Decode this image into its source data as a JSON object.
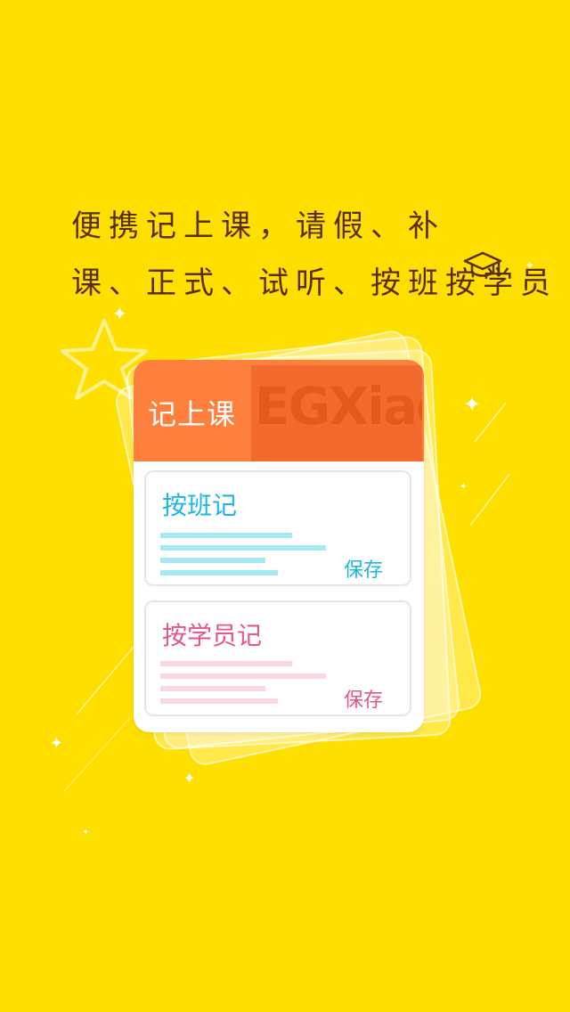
{
  "headline": {
    "line1": "便携记上课，请假、补",
    "line2": "课、正式、试听、按班按学员"
  },
  "card": {
    "title": "记上课",
    "watermark": "EGXiao",
    "options": [
      {
        "title": "按班记",
        "save": "保存",
        "color": "#1BB8E0",
        "bar_color": "#A6E9F2"
      },
      {
        "title": "按学员记",
        "save": "保存",
        "color": "#E8558E",
        "bar_color": "#F9D8E2"
      }
    ]
  },
  "colors": {
    "background": "#FFDF00",
    "headline": "#5A2E10",
    "header": "#FF7F3C"
  },
  "icons": [
    "graduation-cap-icon",
    "star-icon",
    "sparkle-icon"
  ]
}
